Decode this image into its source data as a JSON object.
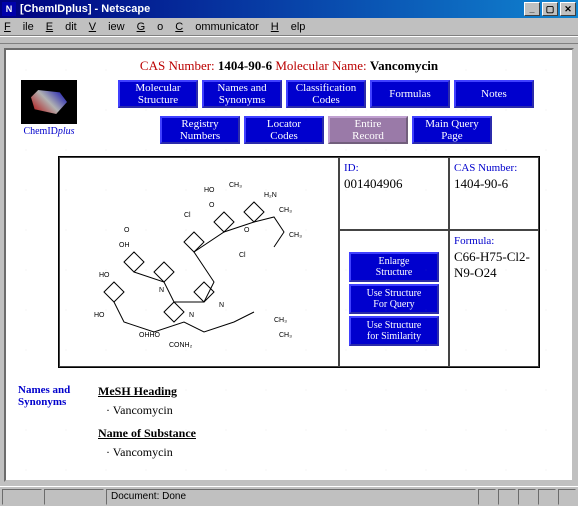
{
  "window": {
    "title": "[ChemIDplus] - Netscape"
  },
  "menu": [
    "File",
    "Edit",
    "View",
    "Go",
    "Communicator",
    "Help"
  ],
  "header": {
    "cas_label": "CAS Number:",
    "cas_value": "1404-90-6",
    "mol_label": "Molecular Name:",
    "mol_value": "Vancomycin"
  },
  "logo": {
    "text_a": "ChemID",
    "text_b": "plus"
  },
  "nav": {
    "molecular_structure": "Molecular\nStructure",
    "names_synonyms": "Names and\nSynonyms",
    "classification_codes": "Classification\nCodes",
    "formulas": "Formulas",
    "notes": "Notes",
    "registry_numbers": "Registry\nNumbers",
    "locator_codes": "Locator\nCodes",
    "entire_record": "Entire\nRecord",
    "main_query": "Main Query\nPage"
  },
  "info": {
    "id_label": "ID:",
    "id_value": "001404906",
    "cas_label": "CAS Number:",
    "cas_value": "1404-90-6",
    "formula_label": "Formula:",
    "formula_value": "C66-H75-Cl2-N9-O24"
  },
  "actions": {
    "enlarge": "Enlarge\nStructure",
    "use_query": "Use Structure\nFor Query",
    "use_sim": "Use Structure\nfor Similarity"
  },
  "synonyms": {
    "section_label": "Names and Synonyms",
    "mesh_heading": "MeSH Heading",
    "mesh_items": [
      "Vancomycin"
    ],
    "name_heading": "Name of Substance",
    "name_items": [
      "Vancomycin"
    ]
  },
  "status": {
    "text": "Document: Done"
  }
}
